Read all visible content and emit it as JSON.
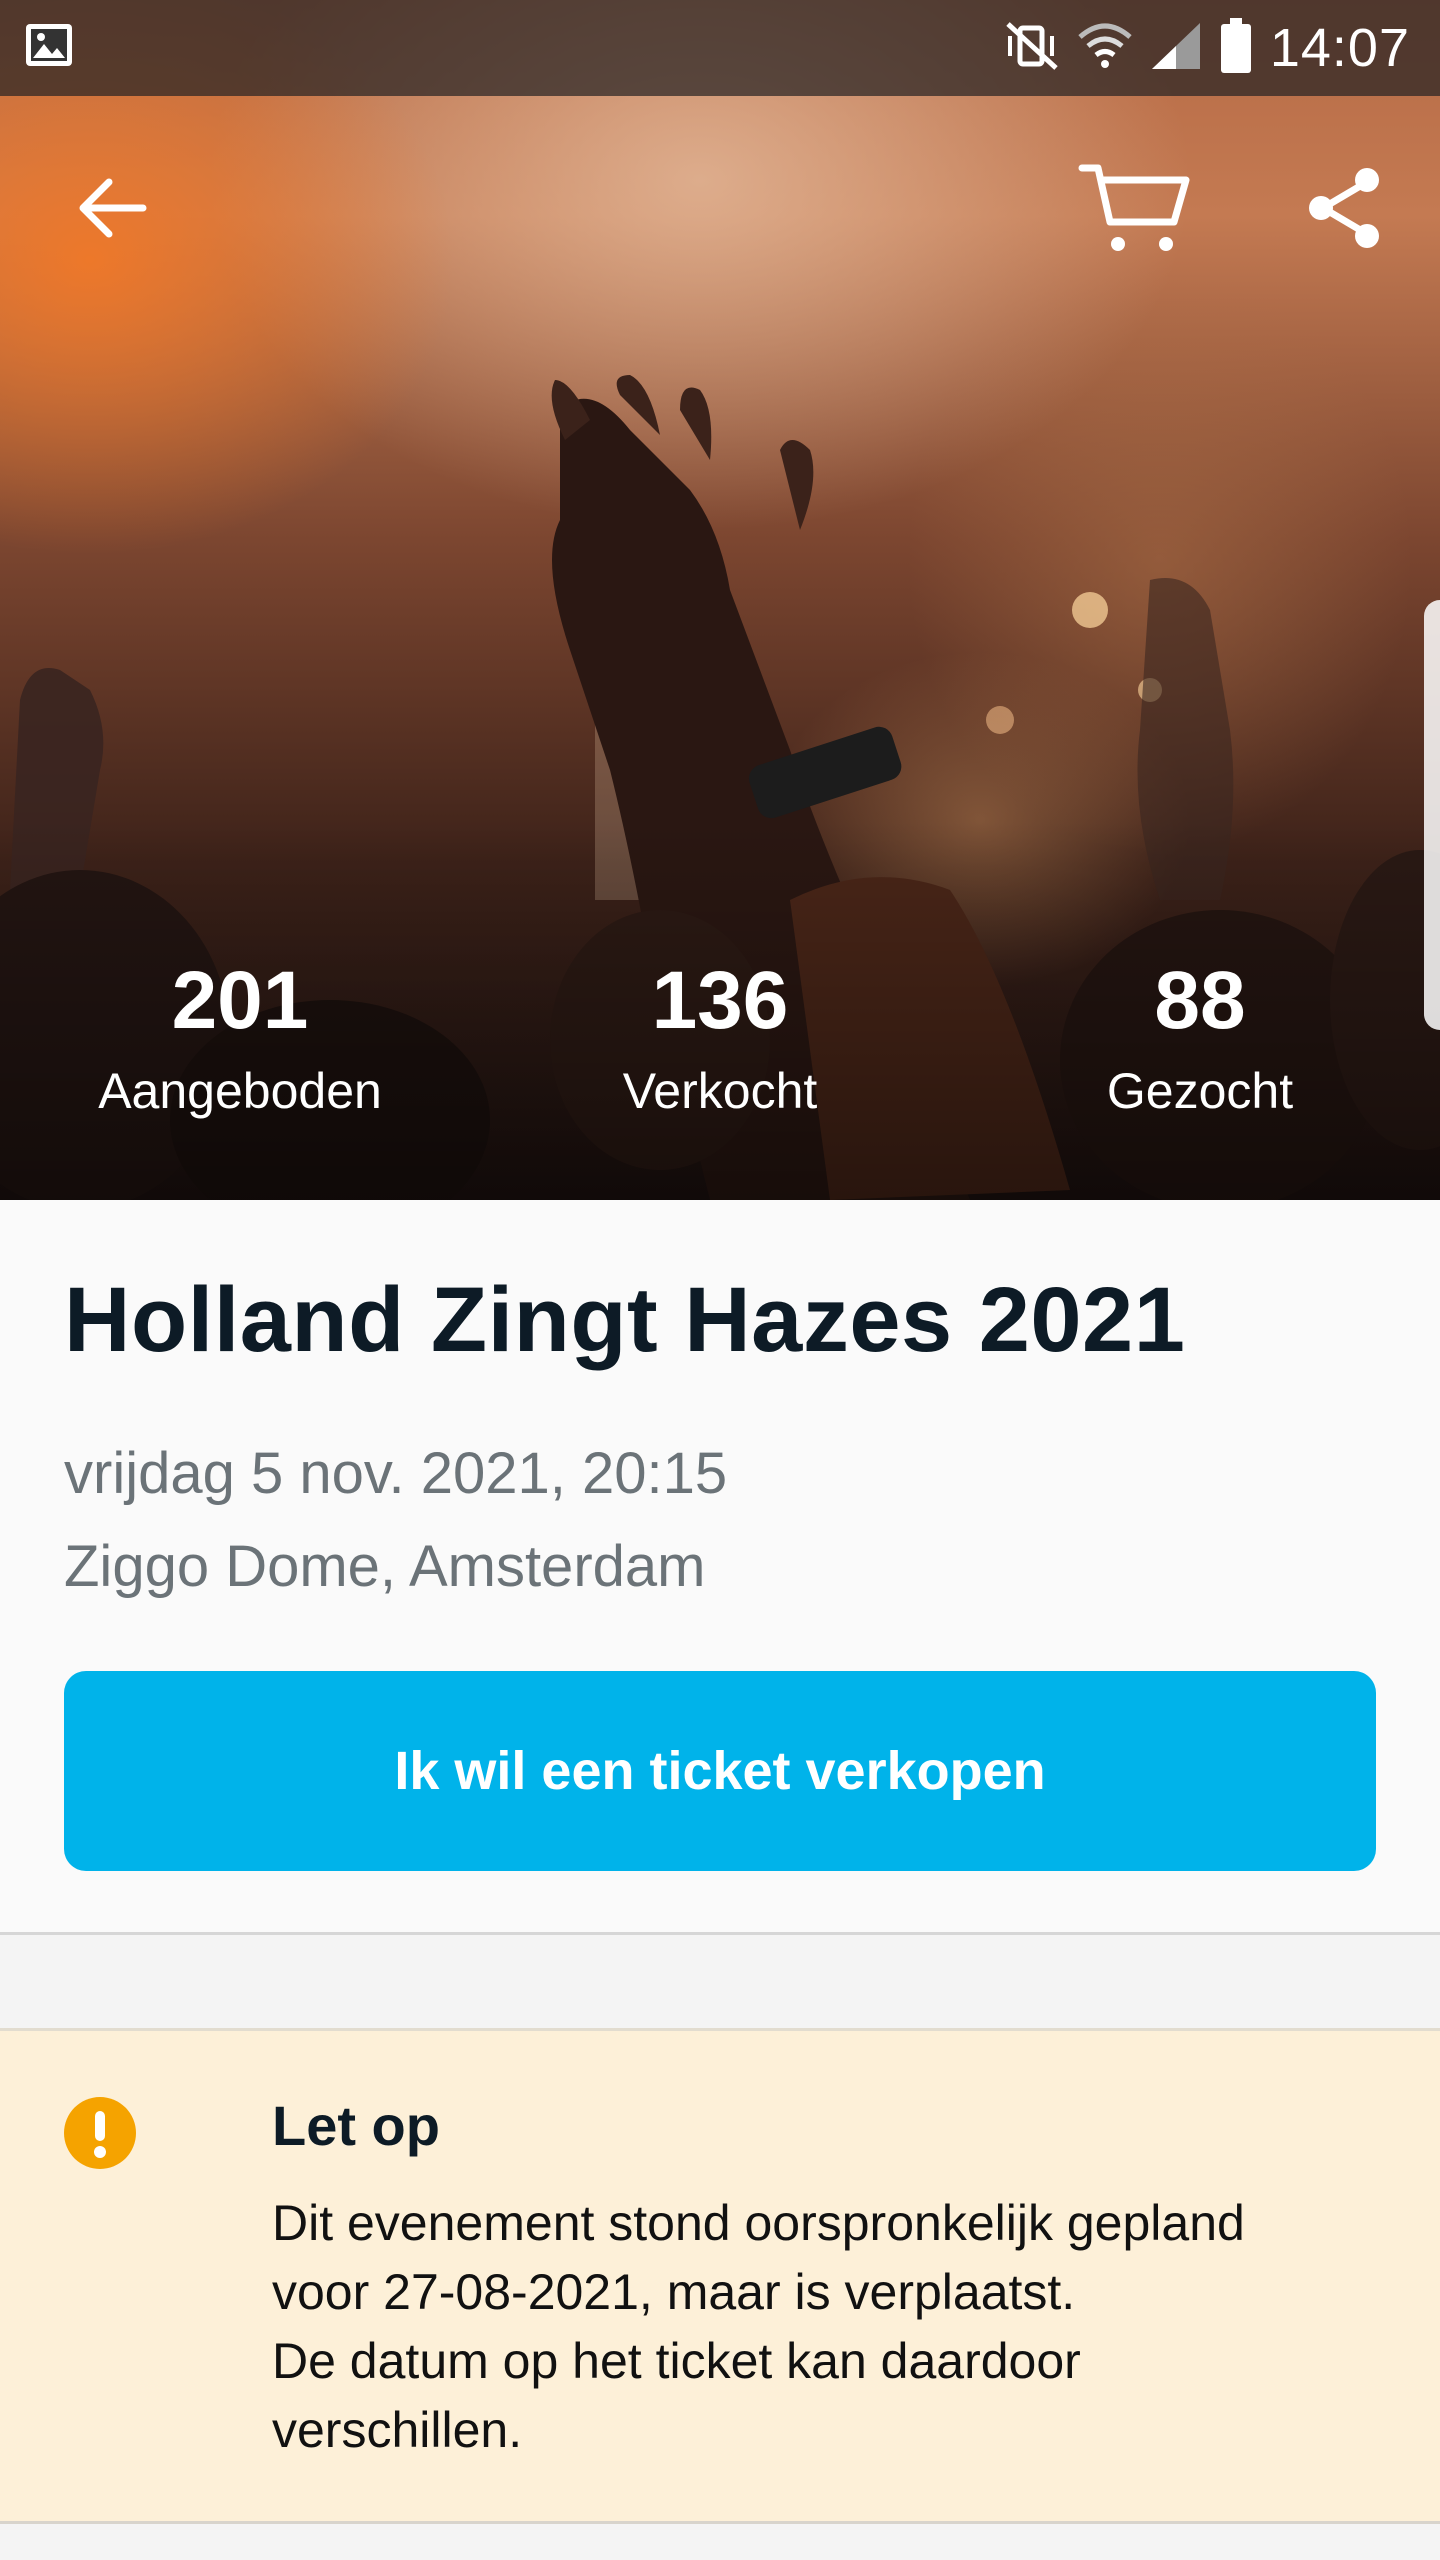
{
  "status_bar": {
    "time": "14:07",
    "icons": [
      "gallery-icon",
      "mute-vibrate-icon",
      "wifi-icon",
      "signal-icon",
      "battery-icon"
    ]
  },
  "toolbar": {
    "icons": [
      "back-arrow-icon",
      "cart-icon",
      "share-icon"
    ]
  },
  "stats": [
    {
      "value": "201",
      "label": "Aangeboden"
    },
    {
      "value": "136",
      "label": "Verkocht"
    },
    {
      "value": "88",
      "label": "Gezocht"
    }
  ],
  "event": {
    "title": "Holland Zingt Hazes 2021",
    "date": "vrijdag 5 nov. 2021, 20:15",
    "venue": "Ziggo Dome, Amsterdam",
    "sell_button_label": "Ik wil een ticket verkopen"
  },
  "notice": {
    "icon": "warning-icon",
    "title": "Let op",
    "line1": "Dit evenement stond oorspronkelijk gepland",
    "line2": "voor 27-08-2021, maar is verplaatst.",
    "line3": "De datum op het ticket kan daardoor",
    "line4": "verschillen."
  },
  "colors": {
    "accent": "#00b3ea",
    "warning": "#f5a300",
    "notice_background": "#fdf0d8"
  }
}
